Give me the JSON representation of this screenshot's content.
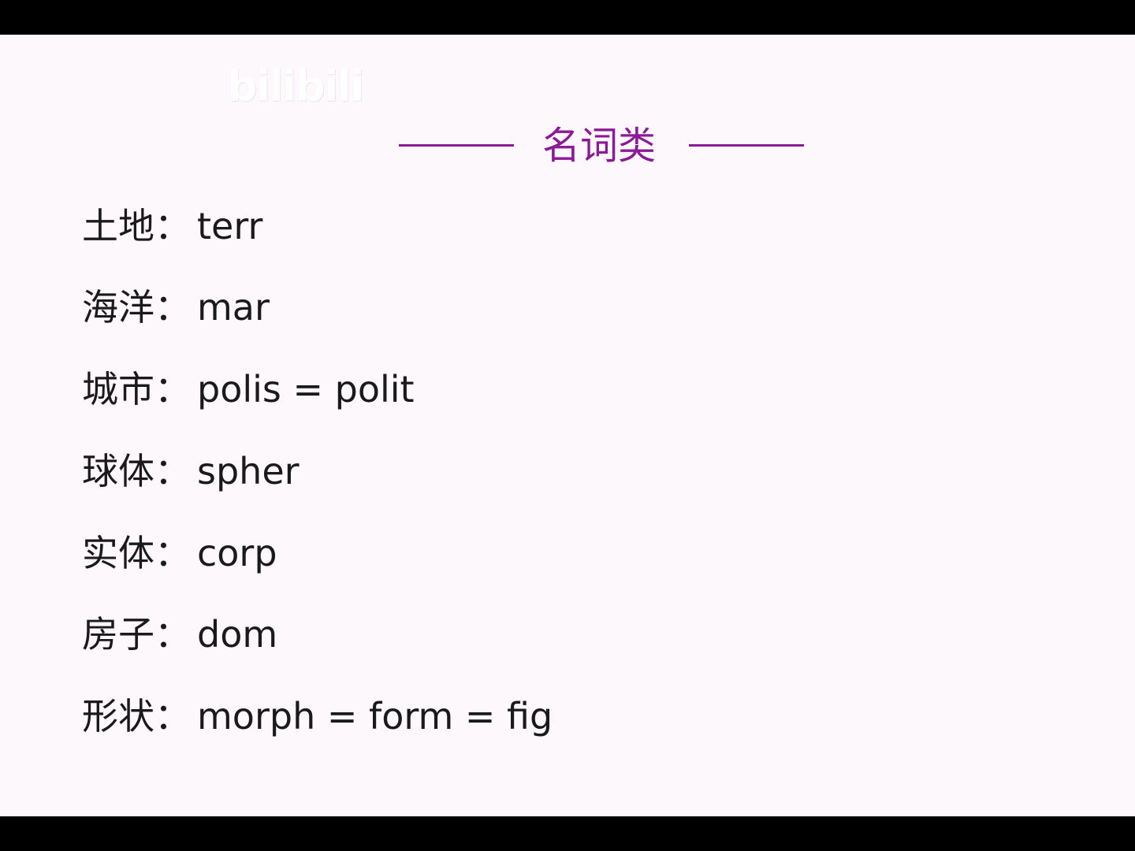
{
  "watermark": "bilibili",
  "title": "名词类",
  "colors": {
    "accent": "#8a1a96",
    "background": "#fcf8fc",
    "text": "#1a1a1a"
  },
  "items": [
    {
      "label": "土地：",
      "value": "terr"
    },
    {
      "label": "海洋：",
      "value": "mar"
    },
    {
      "label": "城市：",
      "value": "polis = polit"
    },
    {
      "label": "球体：",
      "value": "spher"
    },
    {
      "label": "实体：",
      "value": "corp"
    },
    {
      "label": "房子：",
      "value": "dom"
    },
    {
      "label": "形状：",
      "value": "morph = form = fig"
    }
  ]
}
